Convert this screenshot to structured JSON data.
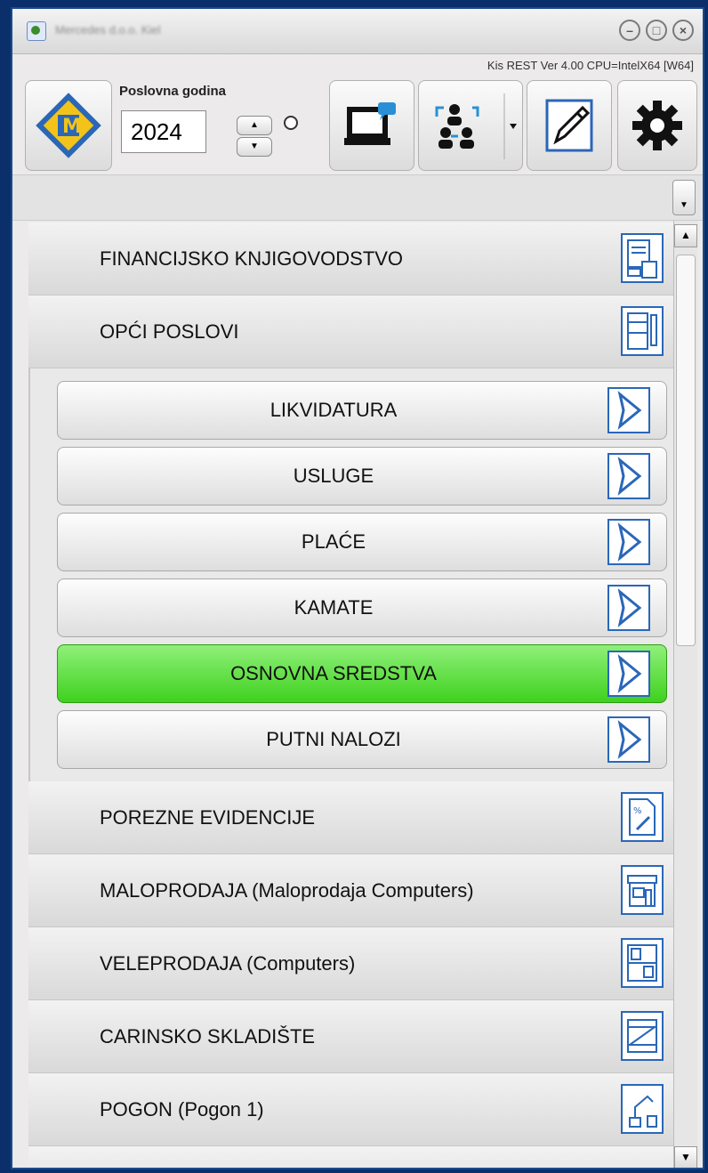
{
  "window": {
    "title": "Mercedes d.o.o. Kiel",
    "version_text": "Kis REST Ver 4.00 CPU=IntelX64 [W64]"
  },
  "toolbar": {
    "year_label": "Poslovna godina",
    "year_value": "2024"
  },
  "sections_top": [
    {
      "label": "FINANCIJSKO KNJIGOVODSTVO",
      "icon": "accounting-calculator-icon"
    },
    {
      "label": "OPĆI POSLOVI",
      "icon": "notebook-pencil-icon"
    }
  ],
  "subitems": [
    {
      "label": "LIKVIDATURA",
      "active": false
    },
    {
      "label": "USLUGE",
      "active": false
    },
    {
      "label": "PLAĆE",
      "active": false
    },
    {
      "label": "KAMATE",
      "active": false
    },
    {
      "label": "OSNOVNA SREDSTVA",
      "active": true
    },
    {
      "label": "PUTNI NALOZI",
      "active": false
    }
  ],
  "sections_bottom": [
    {
      "label": "POREZNE EVIDENCIJE",
      "icon": "tax-document-icon"
    },
    {
      "label": "MALOPRODAJA (Maloprodaja Computers)",
      "icon": "storefront-icon"
    },
    {
      "label": "VELEPRODAJA (Computers)",
      "icon": "warehouse-shelves-icon"
    },
    {
      "label": "CARINSKO SKLADIŠTE",
      "icon": "crate-icon"
    },
    {
      "label": "POGON (Pogon 1)",
      "icon": "robot-arm-icon"
    }
  ],
  "colors": {
    "accent_blue": "#2a67b8",
    "active_green": "#3fd11e"
  }
}
